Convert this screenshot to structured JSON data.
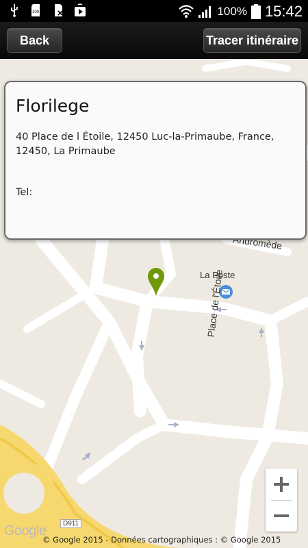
{
  "status_bar": {
    "battery_percent": "100%",
    "time": "15:42",
    "icons": [
      "usb-icon",
      "sd-card-icon",
      "no-sim-icon",
      "play-store-icon",
      "wifi-icon",
      "signal-icon",
      "battery-icon"
    ]
  },
  "action_bar": {
    "back_label": "Back",
    "route_label": "Tracer itinéraire"
  },
  "info_window": {
    "title": "Florilege",
    "address": "40 Place de l Étoile, 12450 Luc-la-Primaube, France, 12450, La Primaube",
    "tel": "Tel:"
  },
  "map": {
    "street_partial": "Andromède",
    "poi_label": "La Poste",
    "street_label": "Place de l'Étoile",
    "road_badge": "D911",
    "google_logo": "Google",
    "attribution": "© Google 2015 - Données cartographiques : © Google 2015",
    "marker_color": "#6e9a0a",
    "zoom_in": "+",
    "zoom_out": "−"
  }
}
